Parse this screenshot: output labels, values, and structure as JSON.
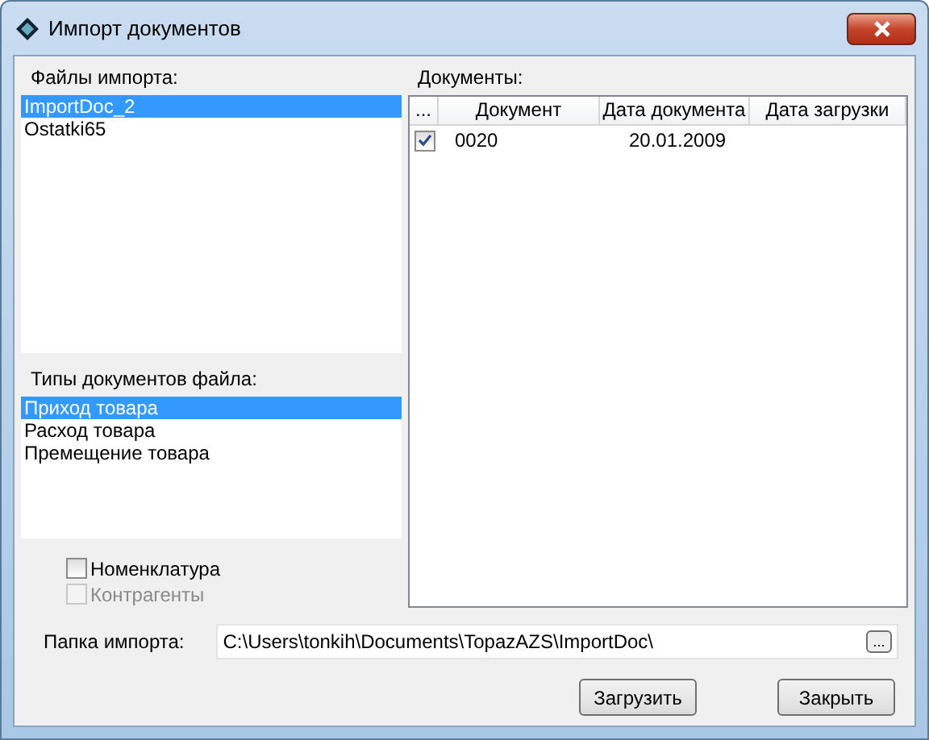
{
  "window": {
    "title": "Импорт документов"
  },
  "files": {
    "label": "Файлы импорта:",
    "items": [
      {
        "label": "ImportDoc_2",
        "selected": true
      },
      {
        "label": "Ostatki65",
        "selected": false
      }
    ]
  },
  "doc_types": {
    "label": "Типы документов файла:",
    "items": [
      {
        "label": "Приход товара",
        "selected": true
      },
      {
        "label": "Расход товара",
        "selected": false
      },
      {
        "label": "Премещение товара",
        "selected": false
      }
    ]
  },
  "options": [
    {
      "label": "Номенклатура",
      "checked": false,
      "disabled": false
    },
    {
      "label": "Контрагенты",
      "checked": false,
      "disabled": true
    }
  ],
  "documents": {
    "label": "Документы:",
    "columns": [
      "...",
      "Документ",
      "Дата документа",
      "Дата загрузки"
    ],
    "rows": [
      {
        "checked": true,
        "document": "0020",
        "date": "20.01.2009"
      }
    ]
  },
  "folder": {
    "label": "Папка импорта:",
    "value": "C:\\Users\\tonkih\\Documents\\TopazAZS\\ImportDoc\\",
    "browse": "..."
  },
  "buttons": [
    "Загрузить",
    "Закрыть"
  ]
}
